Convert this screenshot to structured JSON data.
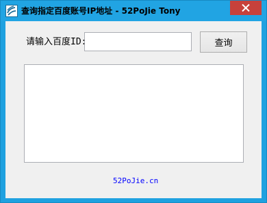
{
  "window": {
    "title": "查询指定百度账号IP地址  - 52PoJie Tony",
    "app_icon": "app-logo-icon",
    "close_icon": "close-icon"
  },
  "form": {
    "id_label": "请输入百度ID:",
    "id_value": "",
    "query_button_label": "查询"
  },
  "result": {
    "text": ""
  },
  "footer": {
    "link_text": "52PoJie.cn"
  },
  "colors": {
    "titlebar": "#21a4e3",
    "close_button": "#c7413b",
    "client_bg": "#f0f0f0",
    "link": "#0000ff"
  }
}
